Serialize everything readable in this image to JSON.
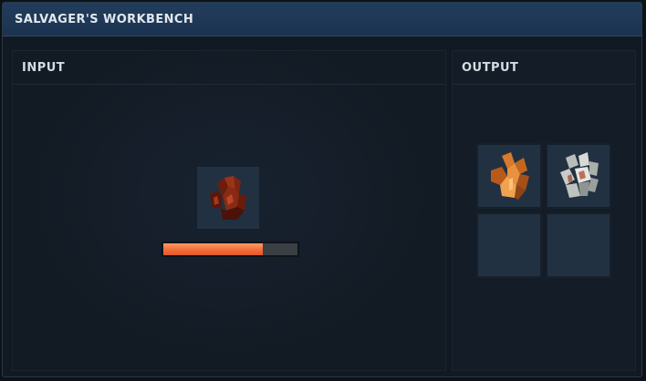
{
  "window": {
    "title": "SALVAGER'S WORKBENCH"
  },
  "input_panel": {
    "header": "INPUT",
    "slots": [
      {
        "item_icon": "red-ore-chunk-icon",
        "item_color": "#8a2a14"
      }
    ],
    "progress": {
      "fraction": 0.74,
      "fill_color": "#f06a36",
      "track_color": "#3a3f44"
    }
  },
  "output_panel": {
    "header": "OUTPUT",
    "slots": [
      {
        "item_icon": "copper-ore-chunk-icon",
        "item_color": "#c2661f"
      },
      {
        "item_icon": "silver-ore-chunk-icon",
        "item_color": "#c9ccc9"
      },
      {
        "item_icon": "",
        "item_color": ""
      },
      {
        "item_icon": "",
        "item_color": ""
      }
    ]
  },
  "colors": {
    "titlebar": "#1f3854",
    "panel": "#141d27",
    "slot": "#223142"
  }
}
